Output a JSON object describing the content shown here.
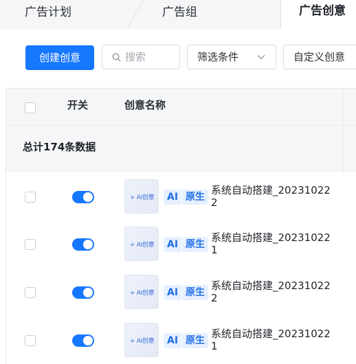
{
  "tabs": {
    "plan": "广告计划",
    "group": "广告组",
    "creative": "广告创意"
  },
  "toolbar": {
    "create_label": "创建创意",
    "search_placeholder": "搜索",
    "filter_label": "筛选条件",
    "custom_label": "自定义创意"
  },
  "table": {
    "headers": {
      "switch": "开关",
      "name": "创意名称"
    },
    "summary": "总计174条数据",
    "rows": [
      {
        "thumb": "+ AI创意",
        "tag_ai": "AI",
        "tag_native": "原生",
        "name": "系统自动搭建_202310222",
        "on": true
      },
      {
        "thumb": "+ AI创意",
        "tag_ai": "AI",
        "tag_native": "原生",
        "name": "系统自动搭建_202310221",
        "on": true
      },
      {
        "thumb": "+ AI创意",
        "tag_ai": "AI",
        "tag_native": "原生",
        "name": "系统自动搭建_202310222",
        "on": true
      },
      {
        "thumb": "+ AI创意",
        "tag_ai": "AI",
        "tag_native": "原生",
        "name": "系统自动搭建_202310221",
        "on": true
      }
    ]
  },
  "colors": {
    "primary": "#1677ff",
    "tag_bg": "#e6f0ff"
  }
}
